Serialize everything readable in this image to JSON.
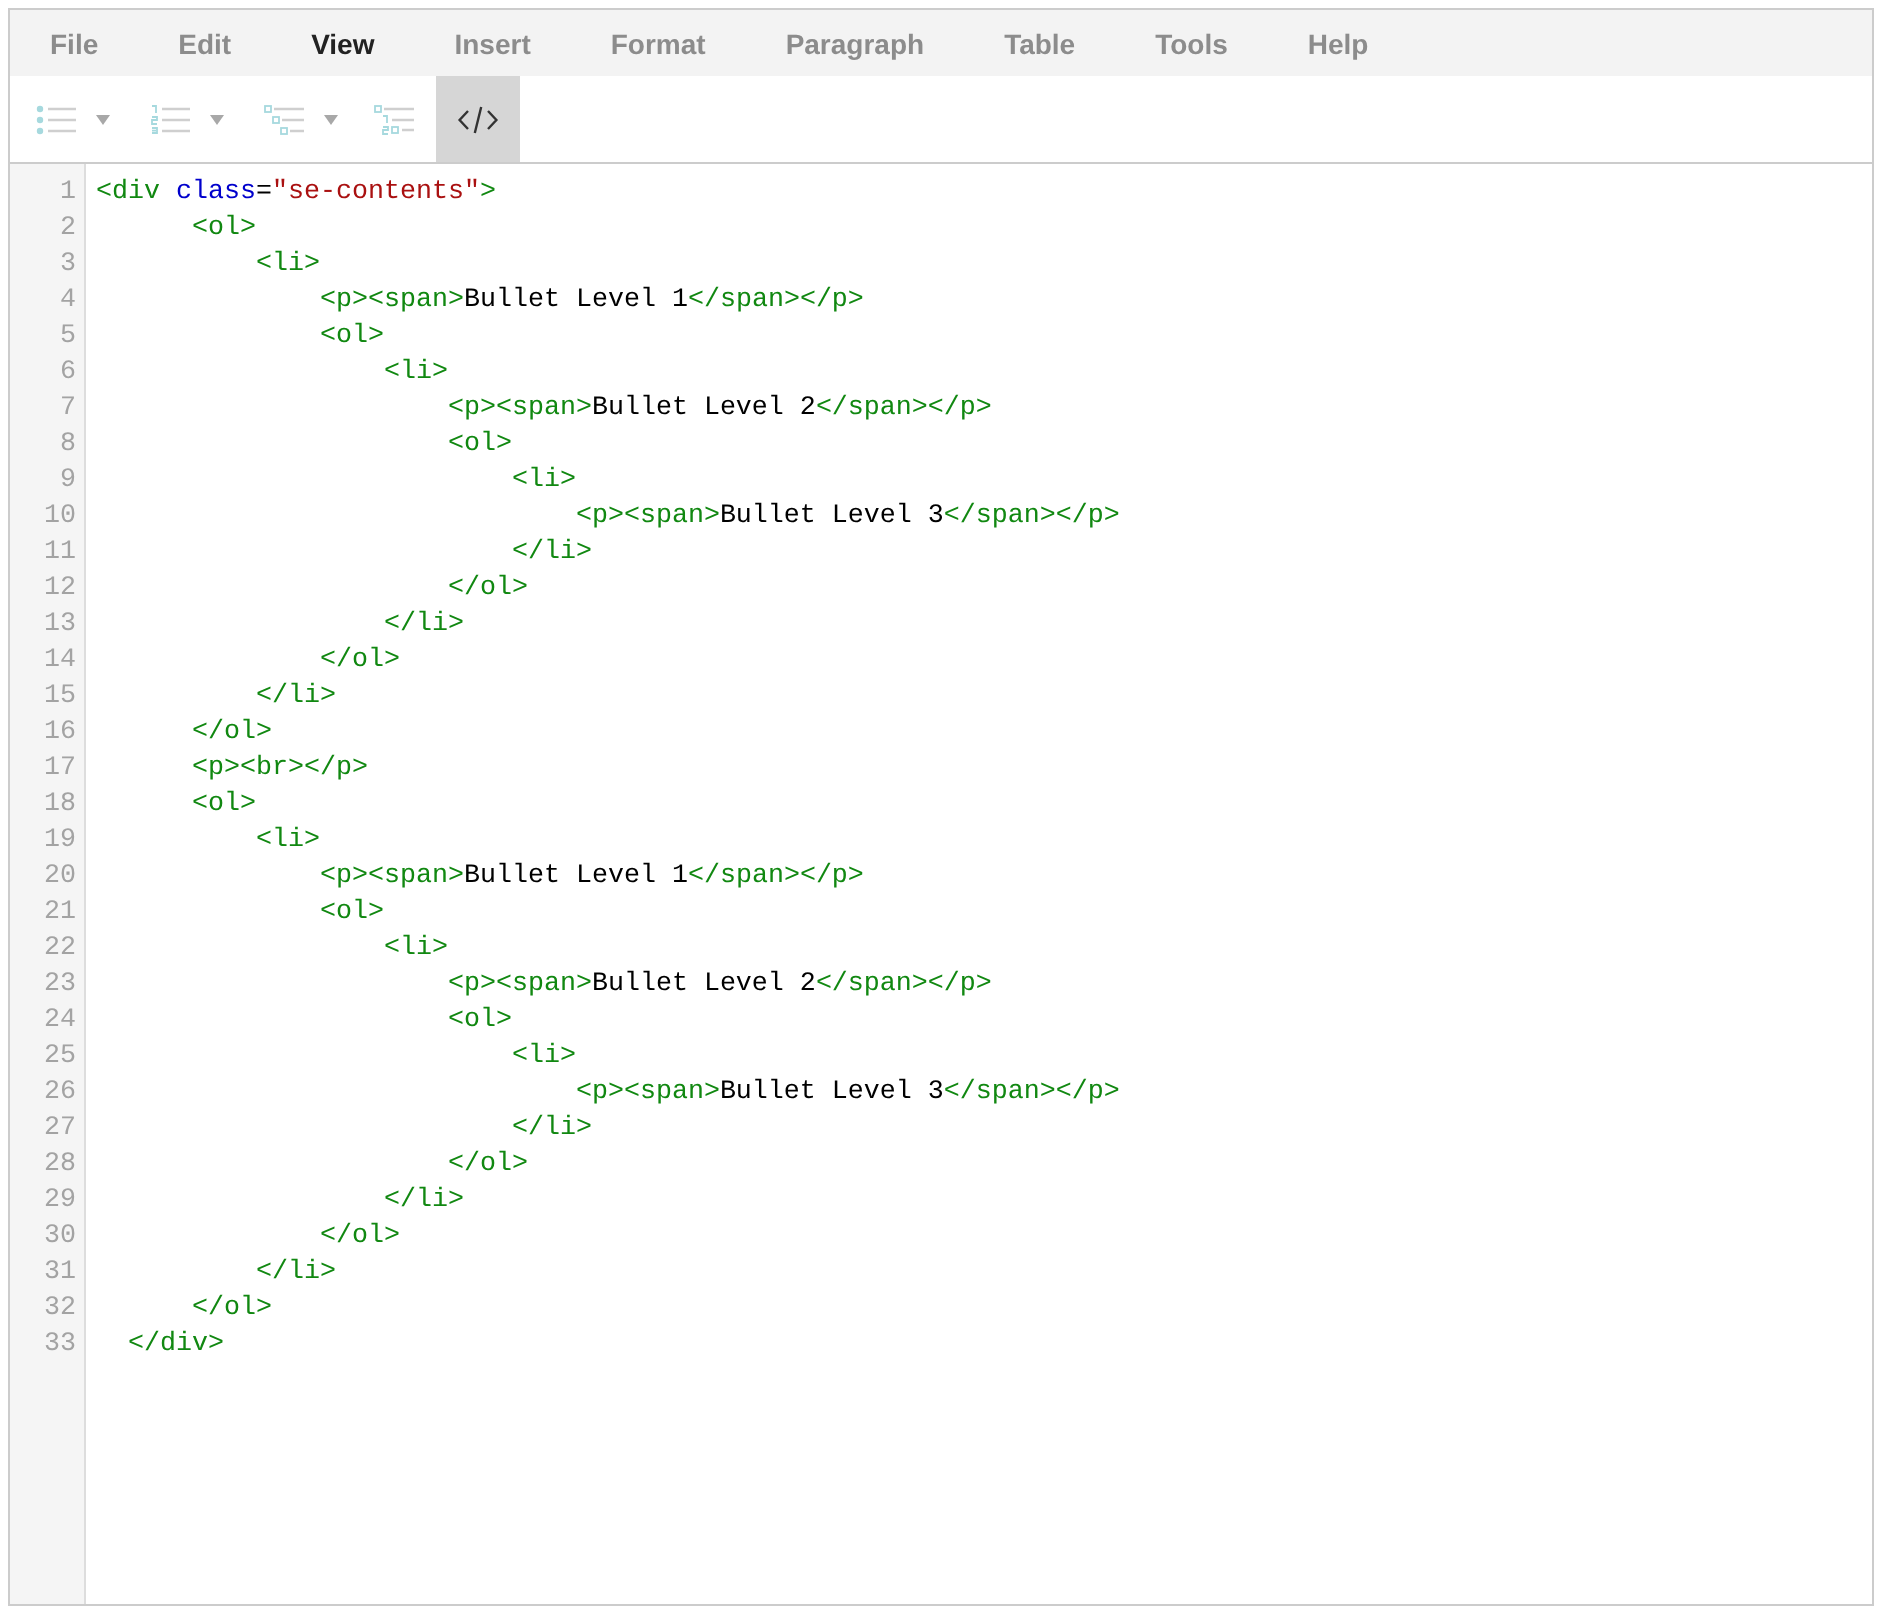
{
  "menu": [
    {
      "label": "File",
      "disabled": true
    },
    {
      "label": "Edit",
      "disabled": true
    },
    {
      "label": "View",
      "disabled": false
    },
    {
      "label": "Insert",
      "disabled": true
    },
    {
      "label": "Format",
      "disabled": true
    },
    {
      "label": "Paragraph",
      "disabled": true
    },
    {
      "label": "Table",
      "disabled": true
    },
    {
      "label": "Tools",
      "disabled": true
    },
    {
      "label": "Help",
      "disabled": true
    }
  ],
  "toolbar": [
    {
      "kind": "bullet-list",
      "dropdown": true,
      "disabled": true,
      "active": false
    },
    {
      "kind": "numbered-list",
      "dropdown": true,
      "disabled": true,
      "active": false
    },
    {
      "kind": "nested-list",
      "dropdown": true,
      "disabled": true,
      "active": false
    },
    {
      "kind": "nested-numbered-list",
      "dropdown": false,
      "disabled": true,
      "active": false
    },
    {
      "kind": "code-view",
      "dropdown": false,
      "disabled": false,
      "active": true
    }
  ],
  "code_view": {
    "lines": [
      {
        "number": "1",
        "code": "<div class=\"se-contents\">"
      },
      {
        "number": "2",
        "code": "      <ol>"
      },
      {
        "number": "3",
        "code": "          <li>"
      },
      {
        "number": "4",
        "code": "              <p><span>Bullet Level 1</span></p>"
      },
      {
        "number": "5",
        "code": "              <ol>"
      },
      {
        "number": "6",
        "code": "                  <li>"
      },
      {
        "number": "7",
        "code": "                      <p><span>Bullet Level 2</span></p>"
      },
      {
        "number": "8",
        "code": "                      <ol>"
      },
      {
        "number": "9",
        "code": "                          <li>"
      },
      {
        "number": "10",
        "code": "                              <p><span>Bullet Level 3</span></p>"
      },
      {
        "number": "11",
        "code": "                          </li>"
      },
      {
        "number": "12",
        "code": "                      </ol>"
      },
      {
        "number": "13",
        "code": "                  </li>"
      },
      {
        "number": "14",
        "code": "              </ol>"
      },
      {
        "number": "15",
        "code": "          </li>"
      },
      {
        "number": "16",
        "code": "      </ol>"
      },
      {
        "number": "17",
        "code": "      <p><br></p>"
      },
      {
        "number": "18",
        "code": "      <ol>"
      },
      {
        "number": "19",
        "code": "          <li>"
      },
      {
        "number": "20",
        "code": "              <p><span>Bullet Level 1</span></p>"
      },
      {
        "number": "21",
        "code": "              <ol>"
      },
      {
        "number": "22",
        "code": "                  <li>"
      },
      {
        "number": "23",
        "code": "                      <p><span>Bullet Level 2</span></p>"
      },
      {
        "number": "24",
        "code": "                      <ol>"
      },
      {
        "number": "25",
        "code": "                          <li>"
      },
      {
        "number": "26",
        "code": "                              <p><span>Bullet Level 3</span></p>"
      },
      {
        "number": "27",
        "code": "                          </li>"
      },
      {
        "number": "28",
        "code": "                      </ol>"
      },
      {
        "number": "29",
        "code": "                  </li>"
      },
      {
        "number": "30",
        "code": "              </ol>"
      },
      {
        "number": "31",
        "code": "          </li>"
      },
      {
        "number": "32",
        "code": "      </ol>"
      },
      {
        "number": "33",
        "code": "  </div>"
      }
    ]
  }
}
